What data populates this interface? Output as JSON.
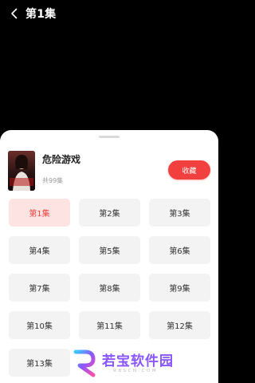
{
  "header": {
    "title": "第1集",
    "back_icon": "chevron-left-icon"
  },
  "drama": {
    "name": "危险游戏",
    "episode_count_text": "共99集",
    "collect_label": "收藏",
    "cover_text": "危险游戏"
  },
  "episodes": [
    {
      "label": "第1集",
      "active": true
    },
    {
      "label": "第2集",
      "active": false
    },
    {
      "label": "第3集",
      "active": false
    },
    {
      "label": "第4集",
      "active": false
    },
    {
      "label": "第5集",
      "active": false
    },
    {
      "label": "第6集",
      "active": false
    },
    {
      "label": "第7集",
      "active": false
    },
    {
      "label": "第8集",
      "active": false
    },
    {
      "label": "第9集",
      "active": false
    },
    {
      "label": "第10集",
      "active": false
    },
    {
      "label": "第11集",
      "active": false
    },
    {
      "label": "第12集",
      "active": false
    },
    {
      "label": "第13集",
      "active": false
    }
  ],
  "watermark": {
    "text": "若宝软件园",
    "sub": "RBSCN.COM"
  },
  "colors": {
    "accent": "#f2403e",
    "active_episode_bg": "#fde4e3",
    "episode_bg": "#f3f3f3",
    "background": "#000000"
  }
}
